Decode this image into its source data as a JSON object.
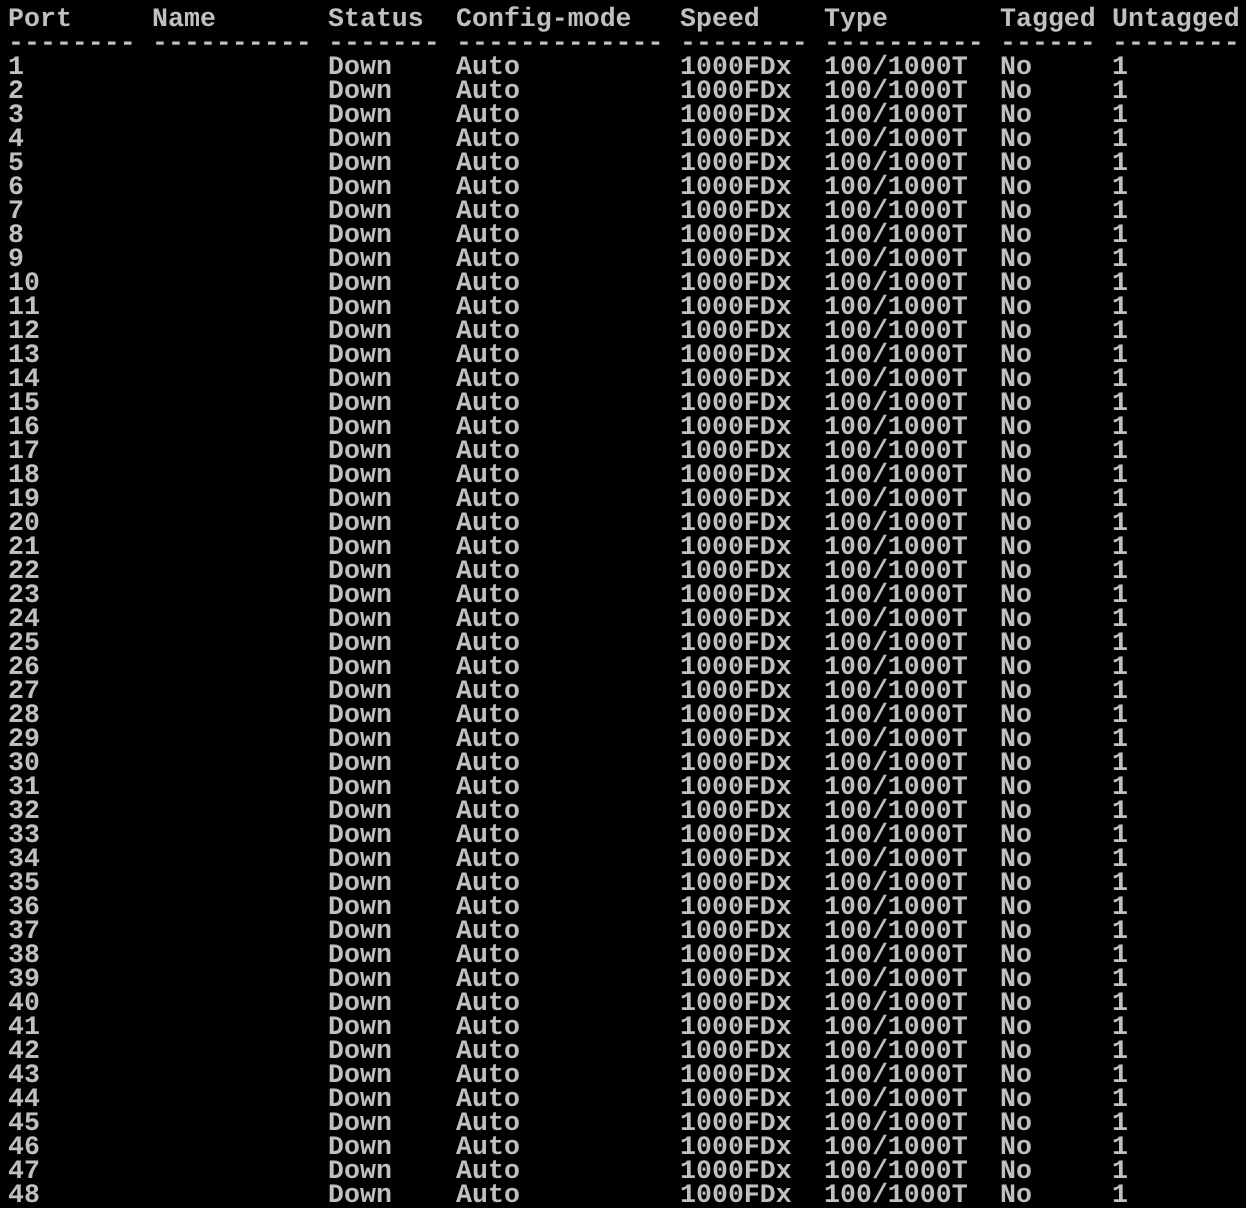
{
  "table": {
    "columns": [
      {
        "label": "Port",
        "underline": "--------"
      },
      {
        "label": "Name",
        "underline": "----------"
      },
      {
        "label": "Status",
        "underline": "-------"
      },
      {
        "label": "Config-mode",
        "underline": "-------------"
      },
      {
        "label": "Speed",
        "underline": "--------"
      },
      {
        "label": "Type",
        "underline": "----------"
      },
      {
        "label": "Tagged",
        "underline": "------"
      },
      {
        "label": "Untagged",
        "underline": "--------"
      }
    ],
    "rows": [
      [
        "1",
        "",
        "Down",
        "Auto",
        "1000FDx",
        "100/1000T",
        "No",
        "1"
      ],
      [
        "2",
        "",
        "Down",
        "Auto",
        "1000FDx",
        "100/1000T",
        "No",
        "1"
      ],
      [
        "3",
        "",
        "Down",
        "Auto",
        "1000FDx",
        "100/1000T",
        "No",
        "1"
      ],
      [
        "4",
        "",
        "Down",
        "Auto",
        "1000FDx",
        "100/1000T",
        "No",
        "1"
      ],
      [
        "5",
        "",
        "Down",
        "Auto",
        "1000FDx",
        "100/1000T",
        "No",
        "1"
      ],
      [
        "6",
        "",
        "Down",
        "Auto",
        "1000FDx",
        "100/1000T",
        "No",
        "1"
      ],
      [
        "7",
        "",
        "Down",
        "Auto",
        "1000FDx",
        "100/1000T",
        "No",
        "1"
      ],
      [
        "8",
        "",
        "Down",
        "Auto",
        "1000FDx",
        "100/1000T",
        "No",
        "1"
      ],
      [
        "9",
        "",
        "Down",
        "Auto",
        "1000FDx",
        "100/1000T",
        "No",
        "1"
      ],
      [
        "10",
        "",
        "Down",
        "Auto",
        "1000FDx",
        "100/1000T",
        "No",
        "1"
      ],
      [
        "11",
        "",
        "Down",
        "Auto",
        "1000FDx",
        "100/1000T",
        "No",
        "1"
      ],
      [
        "12",
        "",
        "Down",
        "Auto",
        "1000FDx",
        "100/1000T",
        "No",
        "1"
      ],
      [
        "13",
        "",
        "Down",
        "Auto",
        "1000FDx",
        "100/1000T",
        "No",
        "1"
      ],
      [
        "14",
        "",
        "Down",
        "Auto",
        "1000FDx",
        "100/1000T",
        "No",
        "1"
      ],
      [
        "15",
        "",
        "Down",
        "Auto",
        "1000FDx",
        "100/1000T",
        "No",
        "1"
      ],
      [
        "16",
        "",
        "Down",
        "Auto",
        "1000FDx",
        "100/1000T",
        "No",
        "1"
      ],
      [
        "17",
        "",
        "Down",
        "Auto",
        "1000FDx",
        "100/1000T",
        "No",
        "1"
      ],
      [
        "18",
        "",
        "Down",
        "Auto",
        "1000FDx",
        "100/1000T",
        "No",
        "1"
      ],
      [
        "19",
        "",
        "Down",
        "Auto",
        "1000FDx",
        "100/1000T",
        "No",
        "1"
      ],
      [
        "20",
        "",
        "Down",
        "Auto",
        "1000FDx",
        "100/1000T",
        "No",
        "1"
      ],
      [
        "21",
        "",
        "Down",
        "Auto",
        "1000FDx",
        "100/1000T",
        "No",
        "1"
      ],
      [
        "22",
        "",
        "Down",
        "Auto",
        "1000FDx",
        "100/1000T",
        "No",
        "1"
      ],
      [
        "23",
        "",
        "Down",
        "Auto",
        "1000FDx",
        "100/1000T",
        "No",
        "1"
      ],
      [
        "24",
        "",
        "Down",
        "Auto",
        "1000FDx",
        "100/1000T",
        "No",
        "1"
      ],
      [
        "25",
        "",
        "Down",
        "Auto",
        "1000FDx",
        "100/1000T",
        "No",
        "1"
      ],
      [
        "26",
        "",
        "Down",
        "Auto",
        "1000FDx",
        "100/1000T",
        "No",
        "1"
      ],
      [
        "27",
        "",
        "Down",
        "Auto",
        "1000FDx",
        "100/1000T",
        "No",
        "1"
      ],
      [
        "28",
        "",
        "Down",
        "Auto",
        "1000FDx",
        "100/1000T",
        "No",
        "1"
      ],
      [
        "29",
        "",
        "Down",
        "Auto",
        "1000FDx",
        "100/1000T",
        "No",
        "1"
      ],
      [
        "30",
        "",
        "Down",
        "Auto",
        "1000FDx",
        "100/1000T",
        "No",
        "1"
      ],
      [
        "31",
        "",
        "Down",
        "Auto",
        "1000FDx",
        "100/1000T",
        "No",
        "1"
      ],
      [
        "32",
        "",
        "Down",
        "Auto",
        "1000FDx",
        "100/1000T",
        "No",
        "1"
      ],
      [
        "33",
        "",
        "Down",
        "Auto",
        "1000FDx",
        "100/1000T",
        "No",
        "1"
      ],
      [
        "34",
        "",
        "Down",
        "Auto",
        "1000FDx",
        "100/1000T",
        "No",
        "1"
      ],
      [
        "35",
        "",
        "Down",
        "Auto",
        "1000FDx",
        "100/1000T",
        "No",
        "1"
      ],
      [
        "36",
        "",
        "Down",
        "Auto",
        "1000FDx",
        "100/1000T",
        "No",
        "1"
      ],
      [
        "37",
        "",
        "Down",
        "Auto",
        "1000FDx",
        "100/1000T",
        "No",
        "1"
      ],
      [
        "38",
        "",
        "Down",
        "Auto",
        "1000FDx",
        "100/1000T",
        "No",
        "1"
      ],
      [
        "39",
        "",
        "Down",
        "Auto",
        "1000FDx",
        "100/1000T",
        "No",
        "1"
      ],
      [
        "40",
        "",
        "Down",
        "Auto",
        "1000FDx",
        "100/1000T",
        "No",
        "1"
      ],
      [
        "41",
        "",
        "Down",
        "Auto",
        "1000FDx",
        "100/1000T",
        "No",
        "1"
      ],
      [
        "42",
        "",
        "Down",
        "Auto",
        "1000FDx",
        "100/1000T",
        "No",
        "1"
      ],
      [
        "43",
        "",
        "Down",
        "Auto",
        "1000FDx",
        "100/1000T",
        "No",
        "1"
      ],
      [
        "44",
        "",
        "Down",
        "Auto",
        "1000FDx",
        "100/1000T",
        "No",
        "1"
      ],
      [
        "45",
        "",
        "Down",
        "Auto",
        "1000FDx",
        "100/1000T",
        "No",
        "1"
      ],
      [
        "46",
        "",
        "Down",
        "Auto",
        "1000FDx",
        "100/1000T",
        "No",
        "1"
      ],
      [
        "47",
        "",
        "Down",
        "Auto",
        "1000FDx",
        "100/1000T",
        "No",
        "1"
      ],
      [
        "48",
        "",
        "Down",
        "Auto",
        "1000FDx",
        "100/1000T",
        "No",
        "1"
      ]
    ]
  }
}
